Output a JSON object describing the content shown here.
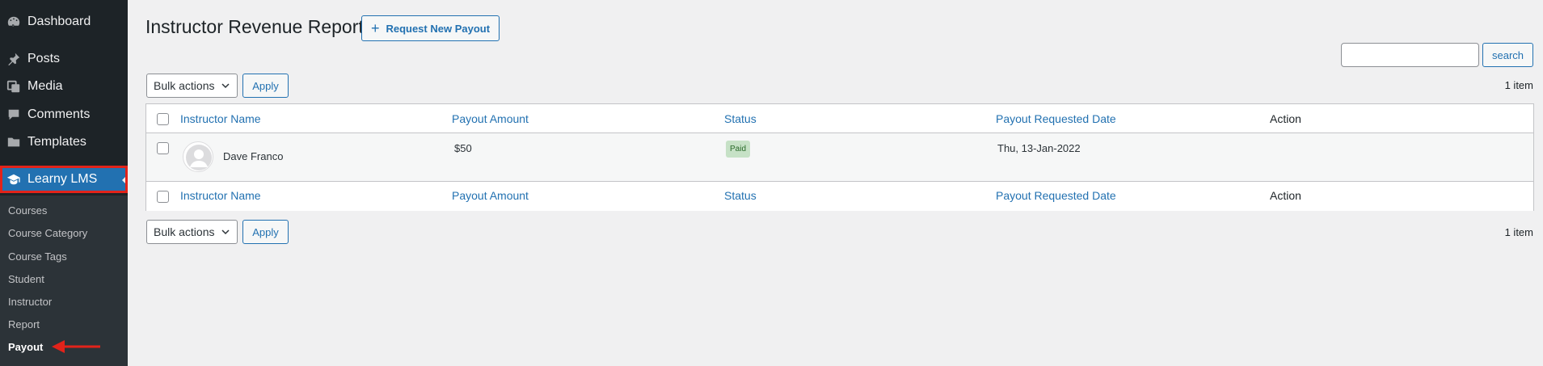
{
  "sidebar": {
    "items": [
      {
        "label": "Dashboard",
        "icon": "dashboard-icon"
      },
      {
        "label": "Posts",
        "icon": "pin-icon"
      },
      {
        "label": "Media",
        "icon": "media-icon"
      },
      {
        "label": "Comments",
        "icon": "comment-icon"
      },
      {
        "label": "Templates",
        "icon": "folder-icon"
      },
      {
        "label": "Learny LMS",
        "icon": "graduation-cap-icon",
        "active": true
      }
    ],
    "submenu": [
      "Courses",
      "Course Category",
      "Course Tags",
      "Student",
      "Instructor",
      "Report",
      "Payout"
    ],
    "current_submenu": "Payout"
  },
  "header": {
    "title": "Instructor Revenue Report",
    "request_button": "Request New Payout"
  },
  "search": {
    "placeholder": "",
    "button": "search"
  },
  "toolbar": {
    "bulk_label": "Bulk actions",
    "apply_label": "Apply",
    "item_count": "1 item"
  },
  "table": {
    "columns": [
      "Instructor Name",
      "Payout Amount",
      "Status",
      "Payout Requested Date",
      "Action"
    ],
    "rows": [
      {
        "instructor": "Dave Franco",
        "amount": "$50",
        "status": "Paid",
        "date": "Thu, 13-Jan-2022",
        "action": ""
      }
    ]
  },
  "colors": {
    "sidebar_bg": "#1d2327",
    "accent": "#2271b1",
    "annotation_red": "#e2231a",
    "paid_badge": "#c6e1c6"
  }
}
